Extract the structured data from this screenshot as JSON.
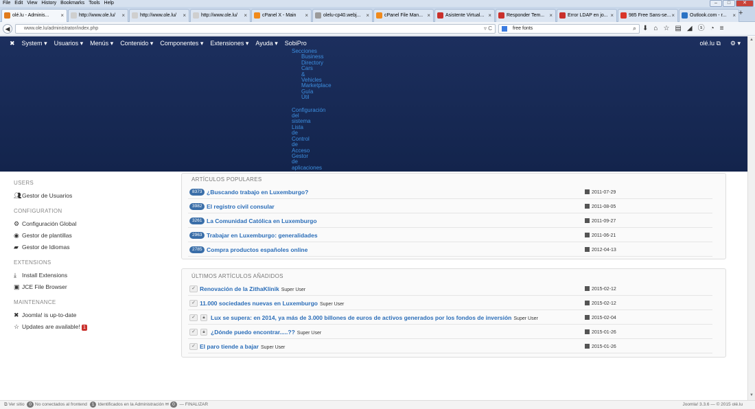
{
  "browser": {
    "menu": [
      "File",
      "Edit",
      "View",
      "History",
      "Bookmarks",
      "Tools",
      "Help"
    ],
    "tabs": [
      {
        "label": "olé.lu - Adminis...",
        "color": "#e07b1c",
        "active": true
      },
      {
        "label": "http://www.ole.lu/",
        "color": "#cfcfcf"
      },
      {
        "label": "http://www.ole.lu/",
        "color": "#cfcfcf"
      },
      {
        "label": "http://www.ole.lu/",
        "color": "#cfcfcf"
      },
      {
        "label": "cPanel X - Main",
        "color": "#f08a1c"
      },
      {
        "label": "olelu-cp40.webj...",
        "color": "#9b9b9b"
      },
      {
        "label": "cPanel File Man...",
        "color": "#f08a1c"
      },
      {
        "label": "Asistente Virtual...",
        "color": "#c9302c"
      },
      {
        "label": "Responder Tem...",
        "color": "#c9302c"
      },
      {
        "label": "Error LDAP en jo...",
        "color": "#c9302c"
      },
      {
        "label": "985 Free Sans-se...",
        "color": "#d9362b"
      },
      {
        "label": "Outlook.com - r...",
        "color": "#2a72c4"
      }
    ],
    "url": "www.ole.lu/administrator/index.php",
    "search": "free fonts"
  },
  "joomla": {
    "menu": [
      "System",
      "Usuarios",
      "Menús",
      "Contenido",
      "Componentes",
      "Extensiones",
      "Ayuda",
      "SobiPro"
    ],
    "user": "olé.lu",
    "submenu": {
      "secciones": "Secciones",
      "items": [
        "Business",
        "Directory",
        "Cars",
        "&",
        "Vehicles",
        "Marketplace",
        "Guía",
        "Útil"
      ],
      "config": [
        "Configuración",
        "del",
        "sistema",
        "Lista",
        "de",
        "Control",
        "de",
        "Acceso",
        "Gestor",
        "de",
        "aplicaciones"
      ]
    }
  },
  "sidebar": {
    "users_head": "USERS",
    "users_items": [
      "Gestor de Usuarios"
    ],
    "config_head": "CONFIGURATION",
    "config_items": [
      "Configuración Global",
      "Gestor de plantillas",
      "Gestor de Idiomas"
    ],
    "ext_head": "EXTENSIONS",
    "ext_items": [
      "Install Extensions",
      "JCE File Browser"
    ],
    "maint_head": "MAINTENANCE",
    "maint_items": [
      "Joomla! is up-to-date",
      "Updates are available!"
    ],
    "updates_count": "1"
  },
  "popular": {
    "title": "ARTÍCULOS POPULARES",
    "rows": [
      {
        "hits": "8373",
        "title": "¿Buscando trabajo en Luxemburgo?",
        "date": "2011-07-29"
      },
      {
        "hits": "3982",
        "title": "El registro civil consular",
        "date": "2011-08-05"
      },
      {
        "hits": "3261",
        "title": "La Comunidad Católica en Luxemburgo",
        "date": "2011-09-27"
      },
      {
        "hits": "2963",
        "title": "Trabajar en Luxemburgo: generalidades",
        "date": "2011-06-21"
      },
      {
        "hits": "2785",
        "title": "Compra productos españoles online",
        "date": "2012-04-13"
      }
    ]
  },
  "latest": {
    "title": "ÚLTIMOS ARTÍCULOS AÑADIDOS",
    "rows": [
      {
        "title": "Renovación de la ZithaKlinik",
        "author": "Super User",
        "date": "2015-02-12",
        "locked": false
      },
      {
        "title": "11.000 sociedades nuevas en Luxemburgo",
        "author": "Super User",
        "date": "2015-02-12",
        "locked": false
      },
      {
        "title": "Lux se supera: en 2014, ya más de 3.000 billones de euros de activos generados por los fondos de inversión",
        "author": "Super User",
        "date": "2015-02-04",
        "locked": true
      },
      {
        "title": "¿Dónde puedo encontrar.....??",
        "author": "Super User",
        "date": "2015-01-26",
        "locked": true
      },
      {
        "title": "El paro tiende a bajar",
        "author": "Super User",
        "date": "2015-01-26",
        "locked": false
      }
    ]
  },
  "status": {
    "view_site": "Ver sitio",
    "frontend_count": "0",
    "frontend_label": "No conectados al frontend",
    "admin_count": "1",
    "admin_label": "Identificados en la Administración",
    "msg_count": "0",
    "logout": "FINALIZAR",
    "version": "Joomla! 3.3.6 — © 2015 olé.lu"
  }
}
